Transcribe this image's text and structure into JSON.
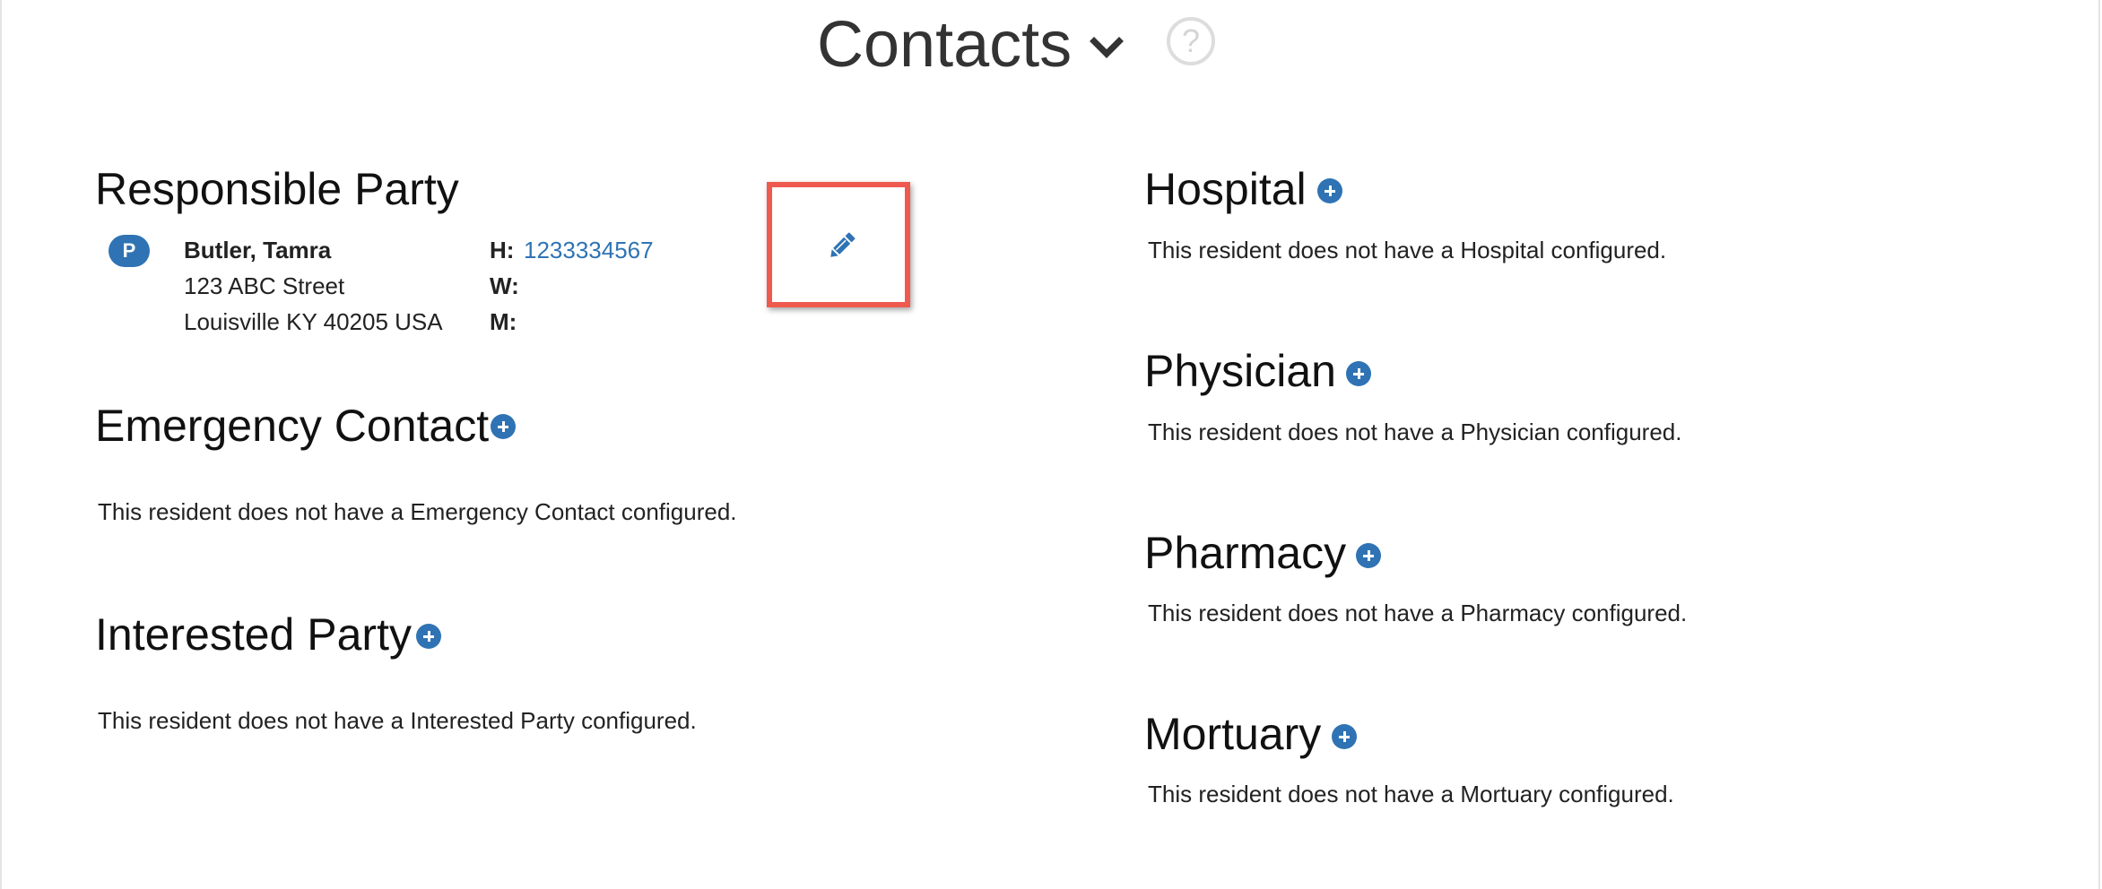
{
  "header": {
    "title": "Contacts",
    "help_glyph": "?"
  },
  "responsible_party": {
    "section_title": "Responsible Party",
    "badge": "P",
    "name": "Butler, Tamra",
    "address_line1": "123 ABC Street",
    "address_line2": "Louisville KY 40205 USA",
    "home_label": "H:",
    "home_phone": "1233334567",
    "work_label": "W:",
    "mobile_label": "M:"
  },
  "emergency_contact": {
    "section_title": "Emergency Contact",
    "empty_message": "This resident does not have a Emergency Contact configured."
  },
  "interested_party": {
    "section_title": "Interested Party",
    "empty_message": "This resident does not have a Interested Party configured."
  },
  "hospital": {
    "section_title": "Hospital",
    "empty_message": "This resident does not have a Hospital configured."
  },
  "physician": {
    "section_title": "Physician",
    "empty_message": "This resident does not have a Physician configured."
  },
  "pharmacy": {
    "section_title": "Pharmacy",
    "empty_message": "This resident does not have a Pharmacy configured."
  },
  "mortuary": {
    "section_title": "Mortuary",
    "empty_message": "This resident does not have a Mortuary configured."
  },
  "colors": {
    "accent": "#2f73b4",
    "highlight_frame": "#ef5a4f"
  },
  "icons": {
    "title_dropdown": "chevron-down-icon",
    "help": "help-circle-icon",
    "add": "plus-circle-icon",
    "edit": "pencil-icon"
  }
}
